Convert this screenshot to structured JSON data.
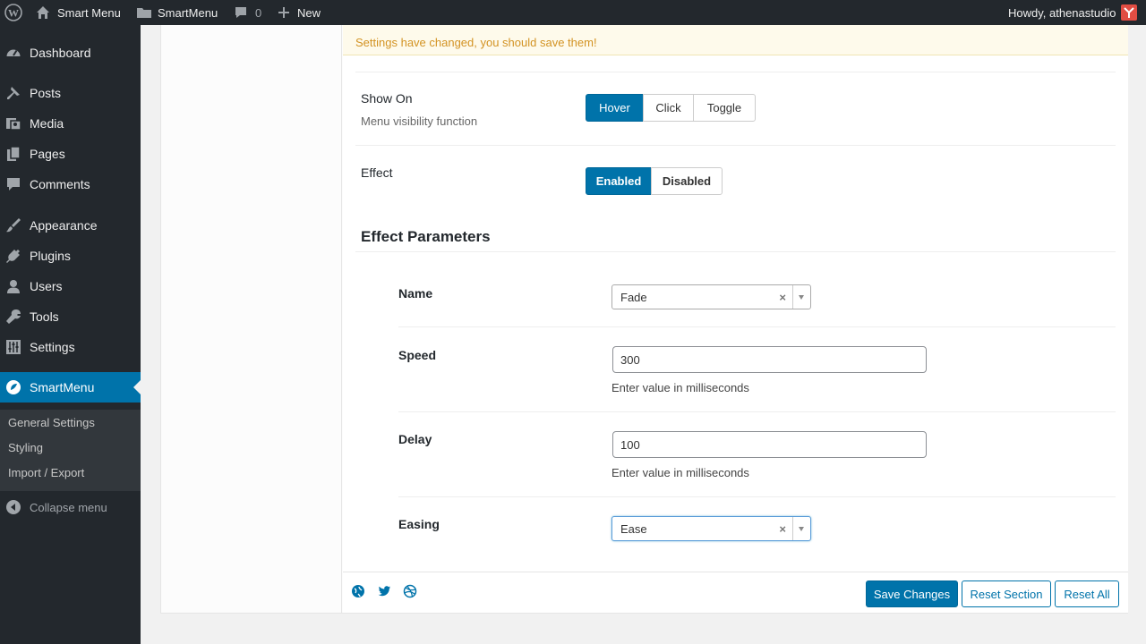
{
  "adminbar": {
    "site_name": "Smart Menu",
    "plugin_link": "SmartMenu",
    "comments_count": "0",
    "new_label": "New",
    "greeting": "Howdy, athenastudio"
  },
  "sidebar": {
    "items": [
      {
        "label": "Dashboard",
        "icon": "dashboard-icon"
      },
      {
        "label": "Posts",
        "icon": "pushpin-icon"
      },
      {
        "label": "Media",
        "icon": "media-icon"
      },
      {
        "label": "Pages",
        "icon": "pages-icon"
      },
      {
        "label": "Comments",
        "icon": "comment-icon"
      },
      {
        "label": "Appearance",
        "icon": "brush-icon"
      },
      {
        "label": "Plugins",
        "icon": "plug-icon"
      },
      {
        "label": "Users",
        "icon": "user-icon"
      },
      {
        "label": "Tools",
        "icon": "wrench-icon"
      },
      {
        "label": "Settings",
        "icon": "sliders-icon"
      },
      {
        "label": "SmartMenu",
        "icon": "smartmenu-icon"
      }
    ],
    "submenu": [
      "General Settings",
      "Styling",
      "Import / Export"
    ],
    "collapse_label": "Collapse menu"
  },
  "notice": "Settings have changed, you should save them!",
  "show_on": {
    "title": "Show On",
    "subtitle": "Menu visibility function",
    "options": [
      "Hover",
      "Click",
      "Toggle"
    ],
    "selected": "Hover"
  },
  "effect": {
    "title": "Effect",
    "options": [
      "Enabled",
      "Disabled"
    ],
    "selected": "Enabled"
  },
  "effect_params": {
    "title": "Effect Parameters",
    "name": {
      "label": "Name",
      "value": "Fade"
    },
    "speed": {
      "label": "Speed",
      "value": "300",
      "description": "Enter value in milliseconds"
    },
    "delay": {
      "label": "Delay",
      "value": "100",
      "description": "Enter value in milliseconds"
    },
    "easing": {
      "label": "Easing",
      "value": "Ease"
    }
  },
  "footer": {
    "save": "Save Changes",
    "reset_section": "Reset Section",
    "reset_all": "Reset All"
  },
  "colors": {
    "accent": "#0073aa",
    "sidebar_bg": "#23282d",
    "notice_text": "#d39323"
  }
}
